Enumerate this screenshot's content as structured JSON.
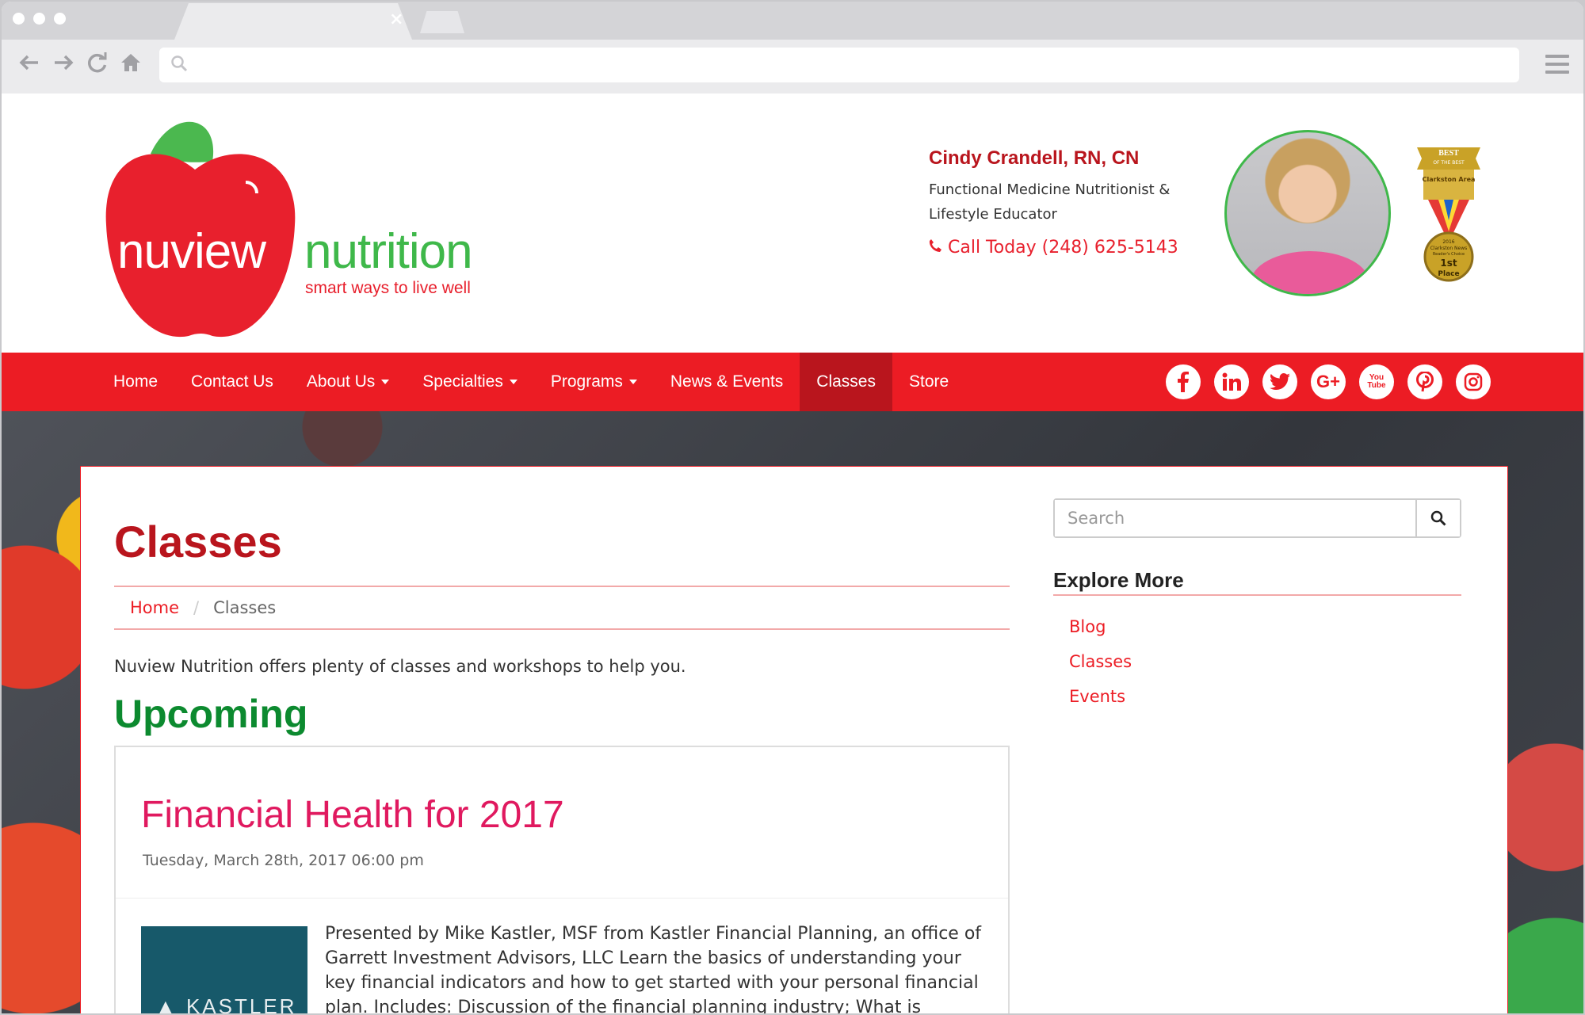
{
  "browser": {
    "tab_close": "×"
  },
  "site": {
    "logo": {
      "brand_left": "nuview",
      "brand_right": "nutrition",
      "tagline": "smart ways to live well"
    },
    "contact": {
      "name": "Cindy Crandell, RN, CN",
      "title_line1": "Functional Medicine Nutritionist &",
      "title_line2": "Lifestyle Educator",
      "phone": "Call Today (248) 625-5143"
    },
    "badge": {
      "line1": "BEST",
      "line2": "OF THE BEST",
      "line3": "Clarkston Area",
      "line4": "2016",
      "line5": "Clarkston News",
      "line6": "Reader's Choice",
      "line7": "1st",
      "line8": "Place"
    },
    "nav": {
      "items": [
        {
          "label": "Home"
        },
        {
          "label": "Contact Us"
        },
        {
          "label": "About Us"
        },
        {
          "label": "Specialties"
        },
        {
          "label": "Programs"
        },
        {
          "label": "News & Events"
        },
        {
          "label": "Classes"
        },
        {
          "label": "Store"
        }
      ],
      "active": "Classes"
    },
    "socials": {
      "facebook": "f",
      "linkedin": "in",
      "twitter": "t",
      "google_plus": "G+",
      "youtube": "You Tube",
      "pinterest": "p",
      "instagram": "ig"
    }
  },
  "main": {
    "page_title": "Classes",
    "breadcrumb": {
      "home": "Home",
      "separator": "/",
      "current": "Classes"
    },
    "intro": "Nuview Nutrition offers plenty of classes and workshops to help you.",
    "section_title": "Upcoming",
    "event": {
      "title": "Financial Health for 2017",
      "date": "Tuesday, March 28th, 2017 06:00 pm",
      "image_text": "KASTLER",
      "description": "Presented by Mike Kastler, MSF from Kastler Financial Planning, an office of Garrett Investment Advisors, LLC Learn the basics of understanding your key financial indicators and how to get started with your personal financial plan. Includes: Discussion of the financial planning industry; What is financial"
    }
  },
  "sidebar": {
    "search_placeholder": "Search",
    "explore_title": "Explore More",
    "links": [
      {
        "label": "Blog"
      },
      {
        "label": "Classes"
      },
      {
        "label": "Events"
      }
    ]
  },
  "colors": {
    "brand_red": "#ec1c24",
    "dark_red": "#b9151d",
    "green": "#3fb84a",
    "heading_green": "#0c8a2f",
    "link_pink": "#e0195f"
  }
}
